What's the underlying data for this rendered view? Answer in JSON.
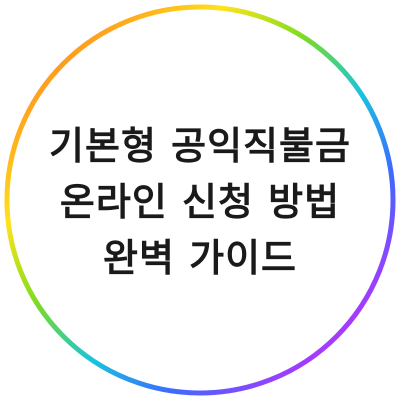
{
  "title": {
    "lines": [
      "기본형 공익직불금",
      "온라인 신청 방법",
      "완벽 가이드"
    ]
  },
  "ring": {
    "colors": [
      "#ff3b3b",
      "#ff9a1f",
      "#ffe21a",
      "#7ddc1f",
      "#19c3e0",
      "#3b6bff",
      "#a33bff",
      "#ff3ba7"
    ]
  }
}
